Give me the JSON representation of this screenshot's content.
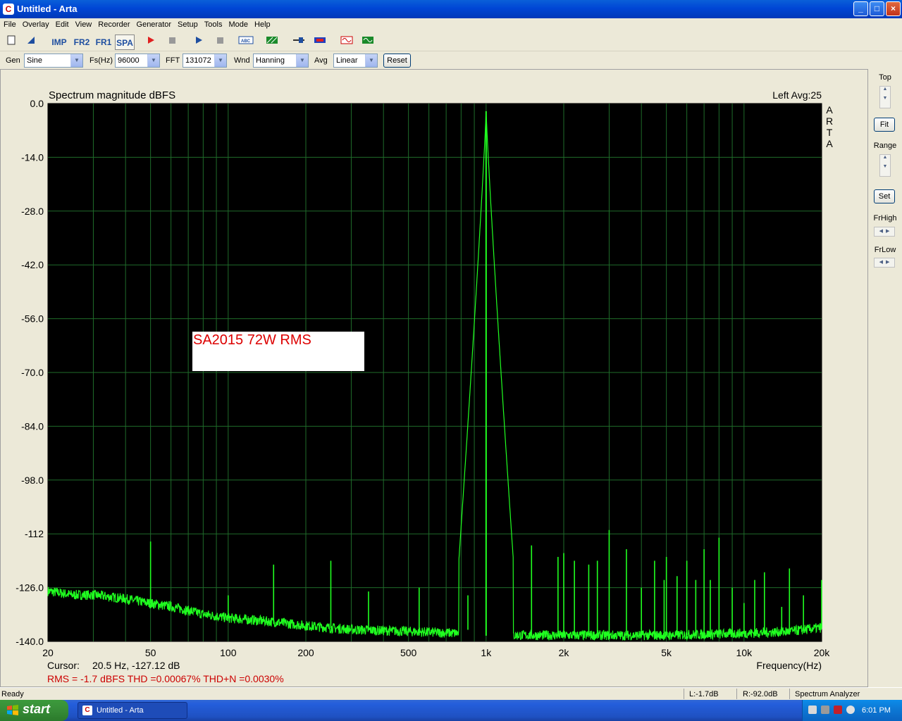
{
  "window": {
    "title": "Untitled - Arta"
  },
  "menu": [
    "File",
    "Overlay",
    "Edit",
    "View",
    "Recorder",
    "Generator",
    "Setup",
    "Tools",
    "Mode",
    "Help"
  ],
  "toolbar": {
    "imp": "IMP",
    "fr2": "FR2",
    "fr1": "FR1",
    "spa": "SPA"
  },
  "controls": {
    "gen_label": "Gen",
    "gen_value": "Sine",
    "fs_label": "Fs(Hz)",
    "fs_value": "96000",
    "fft_label": "FFT",
    "fft_value": "131072",
    "wnd_label": "Wnd",
    "wnd_value": "Hanning",
    "avg_label": "Avg",
    "avg_value": "Linear",
    "reset": "Reset"
  },
  "right_panel": {
    "top": "Top",
    "fit": "Fit",
    "range": "Range",
    "set": "Set",
    "frhigh": "FrHigh",
    "frlow": "FrLow"
  },
  "plot": {
    "title": "Spectrum magnitude dBFS",
    "channel_info": "Left  Avg:25",
    "side_label": [
      "A",
      "R",
      "T",
      "A"
    ],
    "annotation": "SA2015 72W RMS",
    "cursor_label": "Cursor:",
    "cursor_value": "20.5 Hz, -127.12 dB",
    "results": "RMS =   -1.7 dBFS   THD =0.00067%   THD+N =0.0030%",
    "x_axis_label": "Frequency(Hz)"
  },
  "status": {
    "ready": "Ready",
    "left_level": "L:-1.7dB",
    "right_level": "R:-92.0dB",
    "mode": "Spectrum Analyzer"
  },
  "taskbar": {
    "start": "start",
    "task_item": "Untitled - Arta",
    "clock": "6:01 PM"
  },
  "chart_data": {
    "type": "line",
    "title": "Spectrum magnitude dBFS",
    "xlabel": "Frequency(Hz)",
    "ylabel": "",
    "x_scale": "log",
    "xlim": [
      20,
      20000
    ],
    "ylim": [
      -140,
      0
    ],
    "x_ticks": [
      20,
      50,
      100,
      200,
      500,
      1000,
      2000,
      5000,
      10000,
      20000
    ],
    "x_tick_labels": [
      "20",
      "50",
      "100",
      "200",
      "500",
      "1k",
      "2k",
      "5k",
      "10k",
      "20k"
    ],
    "y_ticks": [
      0,
      -14,
      -28,
      -42,
      -56,
      -70,
      -84,
      -98,
      -112,
      -126,
      -140
    ],
    "y_tick_labels": [
      "0.0",
      "-14.0",
      "-28.0",
      "-42.0",
      "-56.0",
      "-70.0",
      "-84.0",
      "-98.0",
      "-112",
      "-126.0",
      "-140.0"
    ],
    "grid": true,
    "colors": {
      "background": "#000000",
      "grid": "#1f6b2a",
      "trace": "#20ff20",
      "results_text": "#cc0000",
      "annotation_text": "#dd0000"
    },
    "series": [
      {
        "noise_floor": [
          [
            20,
            -127
          ],
          [
            25,
            -128
          ],
          [
            30,
            -128
          ],
          [
            40,
            -129
          ],
          [
            48,
            -130
          ],
          [
            60,
            -131
          ],
          [
            80,
            -133
          ],
          [
            100,
            -134
          ],
          [
            150,
            -135
          ],
          [
            200,
            -136
          ],
          [
            300,
            -137
          ],
          [
            500,
            -137.5
          ],
          [
            800,
            -138
          ],
          [
            900,
            -136
          ],
          [
            1000,
            -138.5
          ],
          [
            1200,
            -138.5
          ],
          [
            2000,
            -138.5
          ],
          [
            5000,
            -138.5
          ],
          [
            10000,
            -138
          ],
          [
            15000,
            -137.5
          ],
          [
            20000,
            -136.5
          ]
        ],
        "peaks": [
          {
            "f": 50,
            "db": -114
          },
          {
            "f": 100,
            "db": -128
          },
          {
            "f": 150,
            "db": -120
          },
          {
            "f": 250,
            "db": -119
          },
          {
            "f": 350,
            "db": -127
          },
          {
            "f": 550,
            "db": -126
          },
          {
            "f": 850,
            "db": -128
          },
          {
            "f": 1000,
            "db": -2
          },
          {
            "f": 1500,
            "db": -115
          },
          {
            "f": 1900,
            "db": -118
          },
          {
            "f": 2000,
            "db": -117
          },
          {
            "f": 2200,
            "db": -119
          },
          {
            "f": 2500,
            "db": -120
          },
          {
            "f": 2700,
            "db": -119
          },
          {
            "f": 3000,
            "db": -111
          },
          {
            "f": 3500,
            "db": -116
          },
          {
            "f": 4000,
            "db": -126
          },
          {
            "f": 4500,
            "db": -119
          },
          {
            "f": 4900,
            "db": -124
          },
          {
            "f": 5000,
            "db": -118
          },
          {
            "f": 5500,
            "db": -123
          },
          {
            "f": 6000,
            "db": -119
          },
          {
            "f": 6500,
            "db": -124
          },
          {
            "f": 7000,
            "db": -116
          },
          {
            "f": 7400,
            "db": -124
          },
          {
            "f": 8000,
            "db": -113
          },
          {
            "f": 9000,
            "db": -126
          },
          {
            "f": 10000,
            "db": -130
          },
          {
            "f": 11000,
            "db": -124
          },
          {
            "f": 12000,
            "db": -122
          },
          {
            "f": 14000,
            "db": -131
          },
          {
            "f": 15000,
            "db": -121
          },
          {
            "f": 17000,
            "db": -128
          },
          {
            "f": 20000,
            "db": -124
          }
        ]
      }
    ]
  }
}
